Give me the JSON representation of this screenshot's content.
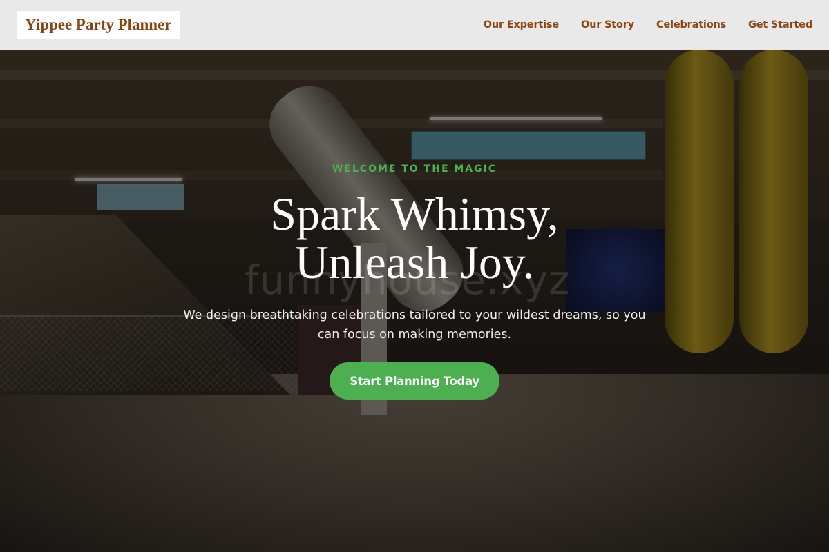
{
  "header": {
    "logo_text": "Yippee Party Planner",
    "nav": [
      {
        "label": "Our Expertise"
      },
      {
        "label": "Our Story"
      },
      {
        "label": "Celebrations"
      },
      {
        "label": "Get Started"
      }
    ]
  },
  "hero": {
    "eyebrow": "WELCOME TO THE MAGIC",
    "headline_line1": "Spark Whimsy,",
    "headline_line2": "Unleash Joy.",
    "subtext": "We design breathtaking celebrations tailored to your wildest dreams, so you can focus on making memories.",
    "cta_label": "Start Planning Today",
    "watermark": "funnyhouse.xyz"
  },
  "colors": {
    "brand_brown": "#8b4513",
    "accent_green": "#4caf50",
    "header_bg": "#e9e9e9"
  }
}
